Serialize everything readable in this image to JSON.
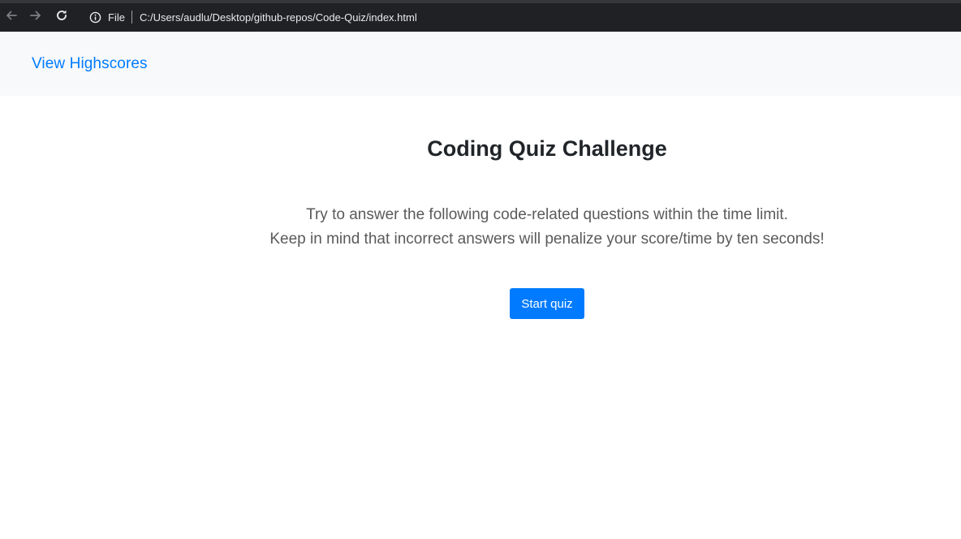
{
  "browser": {
    "scheme_label": "File",
    "url": "C:/Users/audlu/Desktop/github-repos/Code-Quiz/index.html",
    "icons": [
      "back-arrow-icon",
      "forward-arrow-icon",
      "reload-icon",
      "info-icon"
    ]
  },
  "navbar": {
    "highscores_link": "View Highscores"
  },
  "main": {
    "title": "Coding Quiz Challenge",
    "intro_line1": "Try to answer the following code-related questions within the time limit.",
    "intro_line2": "Keep in mind that incorrect answers will penalize your score/time by ten seconds!",
    "start_button": "Start quiz"
  },
  "colors": {
    "accent": "#007bff",
    "navbar_bg": "#f8f9fa",
    "browser_bg": "#202124",
    "title_text": "#212529"
  }
}
